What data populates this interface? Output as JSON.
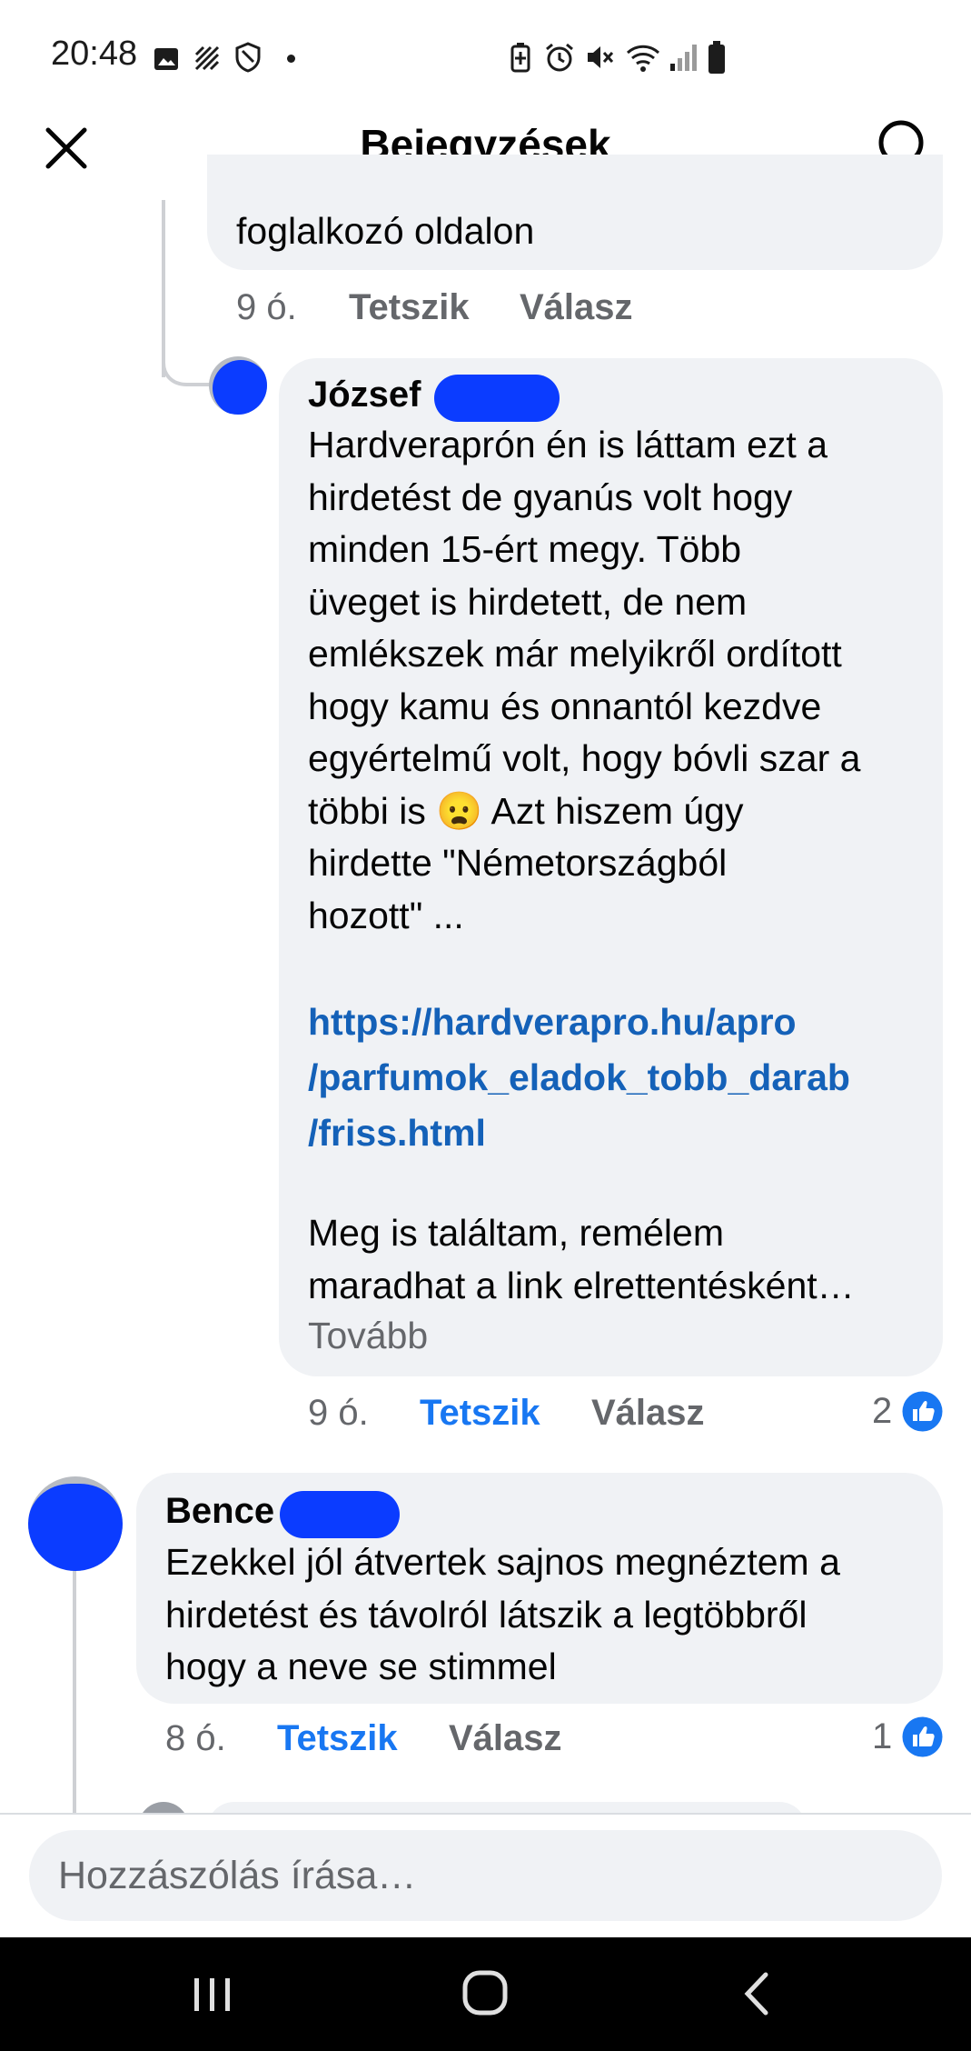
{
  "status_bar": {
    "time": "20:48",
    "left_icons": [
      "gallery-icon",
      "data-saver-icon",
      "shield-icon",
      "dot-icon"
    ],
    "right_icons": [
      "battery-saver-icon",
      "alarm-icon",
      "mute-icon",
      "wifi-icon",
      "signal-icon",
      "battery-icon"
    ]
  },
  "header": {
    "title": "Bejegyzések"
  },
  "comments": [
    {
      "text_partial": "foglalkozó oldalon",
      "time": "9 ó.",
      "like_label": "Tetszik",
      "reply_label": "Válasz"
    },
    {
      "author": "József",
      "body": "Hardveraprón én is láttam ezt a\nhirdetést de gyanús volt hogy\nminden 15-ért megy. Több\nüveget is hirdetett, de nem\nemlékszek már melyikről ordított\nhogy kamu és onnantól kezdve\negyértelmű volt, hogy bóvli szar a\ntöbbi is 😦 Azt hiszem úgy\nhirdette \"Németországból\nhozott\" ...",
      "link": "https://hardverapro.hu/apro\n/parfumok_eladok_tobb_darab\n/friss.html",
      "body2": "Meg is találtam, remélem\nmaradhat a link elrettentésként…",
      "more_label": "Tovább",
      "time": "9 ó.",
      "like_label": "Tetszik",
      "reply_label": "Válasz",
      "reaction_count": "2"
    },
    {
      "author": "Bence",
      "body": "Ezekkel jól átvertek sajnos megnéztem a\nhirdetést és távolról látszik a legtöbbről\nhogy a neve se stimmel",
      "time": "8 ó.",
      "like_label": "Tetszik",
      "reply_label": "Válasz",
      "reaction_count": "1"
    }
  ],
  "composer": {
    "placeholder": "Hozzászólás írása…"
  },
  "colors": {
    "accent": "#1877f2",
    "link": "#1461b8",
    "bubble": "#f0f2f5",
    "secondary_text": "#65676b"
  }
}
